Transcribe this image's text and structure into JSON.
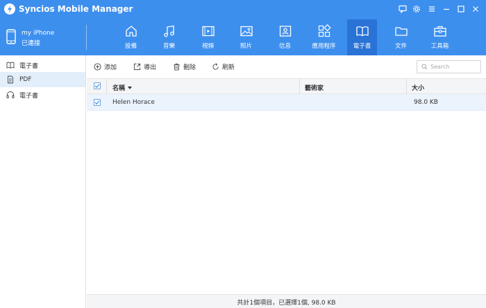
{
  "app": {
    "title": "Syncios Mobile Manager",
    "accent": "#3d8fee",
    "active_tab_color": "#2a73d6",
    "logo_icon": "syncios-logo-icon"
  },
  "window_controls": [
    {
      "name": "feedback-icon"
    },
    {
      "name": "gear-icon"
    },
    {
      "name": "menu-icon"
    },
    {
      "name": "minimize-icon"
    },
    {
      "name": "maximize-icon"
    },
    {
      "name": "close-icon"
    }
  ],
  "device": {
    "name": "my iPhone",
    "status": "已連接",
    "icon": "phone-icon"
  },
  "nav": {
    "tabs": [
      {
        "label": "設備",
        "icon": "home-icon"
      },
      {
        "label": "音樂",
        "icon": "music-icon"
      },
      {
        "label": "視頻",
        "icon": "video-icon"
      },
      {
        "label": "照片",
        "icon": "photo-icon"
      },
      {
        "label": "信息",
        "icon": "contact-card-icon"
      },
      {
        "label": "應用程序",
        "icon": "apps-icon"
      },
      {
        "label": "電子書",
        "icon": "book-icon",
        "active": true
      },
      {
        "label": "文件",
        "icon": "folder-icon"
      },
      {
        "label": "工具箱",
        "icon": "toolbox-icon"
      }
    ]
  },
  "sidebar": {
    "items": [
      {
        "label": "電子書",
        "icon": "book-icon"
      },
      {
        "label": "PDF",
        "icon": "document-icon",
        "active": true
      },
      {
        "label": "電子書",
        "icon": "headphones-icon"
      }
    ]
  },
  "toolbar": {
    "add_label": "添加",
    "export_label": "導出",
    "delete_label": "刪除",
    "refresh_label": "刷新",
    "search_placeholder": "Search"
  },
  "table": {
    "columns": [
      {
        "label": "名稱",
        "sorted": true
      },
      {
        "label": "藝術家"
      },
      {
        "label": "大小"
      }
    ],
    "rows": [
      {
        "name": "Helen Horace",
        "artist": "",
        "size": "98.0 KB",
        "checked": true
      }
    ],
    "header_checked": true
  },
  "status": {
    "text": "共計1個項目，已選擇1個, 98.0 KB"
  }
}
